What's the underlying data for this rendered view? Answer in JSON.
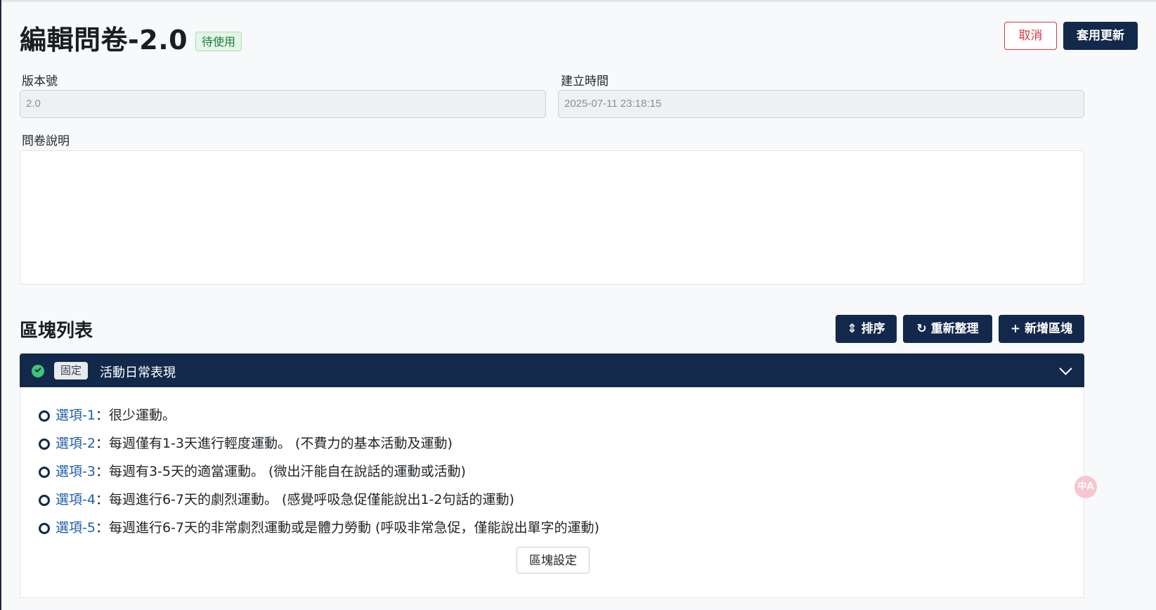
{
  "header": {
    "title": "編輯問卷-2.0",
    "status": "待使用",
    "cancel_label": "取消",
    "apply_label": "套用更新"
  },
  "form": {
    "version_label": "版本號",
    "version_value": "2.0",
    "created_label": "建立時間",
    "created_value": "2025-07-11 23:18:15",
    "description_label": "問卷說明",
    "description_value": ""
  },
  "block_list": {
    "title": "區塊列表",
    "sort_label": "排序",
    "refresh_label": "重新整理",
    "add_label": "新增區塊"
  },
  "block": {
    "badge": "固定",
    "title": "活動日常表現",
    "options": [
      {
        "label": "選項-1",
        "text": "：很少運動。"
      },
      {
        "label": "選項-2",
        "text": "：每週僅有1-3天進行輕度運動。 (不費力的基本活動及運動)"
      },
      {
        "label": "選項-3",
        "text": "：每週有3-5天的適當運動。 (微出汗能自在說話的運動或活動)"
      },
      {
        "label": "選項-4",
        "text": "：每週進行6-7天的劇烈運動。 (感覺呼吸急促僅能說出1-2句話的運動)"
      },
      {
        "label": "選項-5",
        "text": "：每週進行6-7天的非常劇烈運動或是體力勞動 (呼吸非常急促，僅能說出單字的運動)"
      }
    ],
    "settings_label": "區塊設定"
  },
  "colors": {
    "primary": "#13294b",
    "danger": "#dc3545",
    "success": "#3ec476",
    "link": "#1f5fa8"
  },
  "icons": {
    "sort": "sort-icon",
    "refresh": "refresh-icon",
    "add": "plus-icon",
    "check": "check-circle-icon",
    "chevron": "chevron-down-icon",
    "translate": "translate-icon"
  }
}
